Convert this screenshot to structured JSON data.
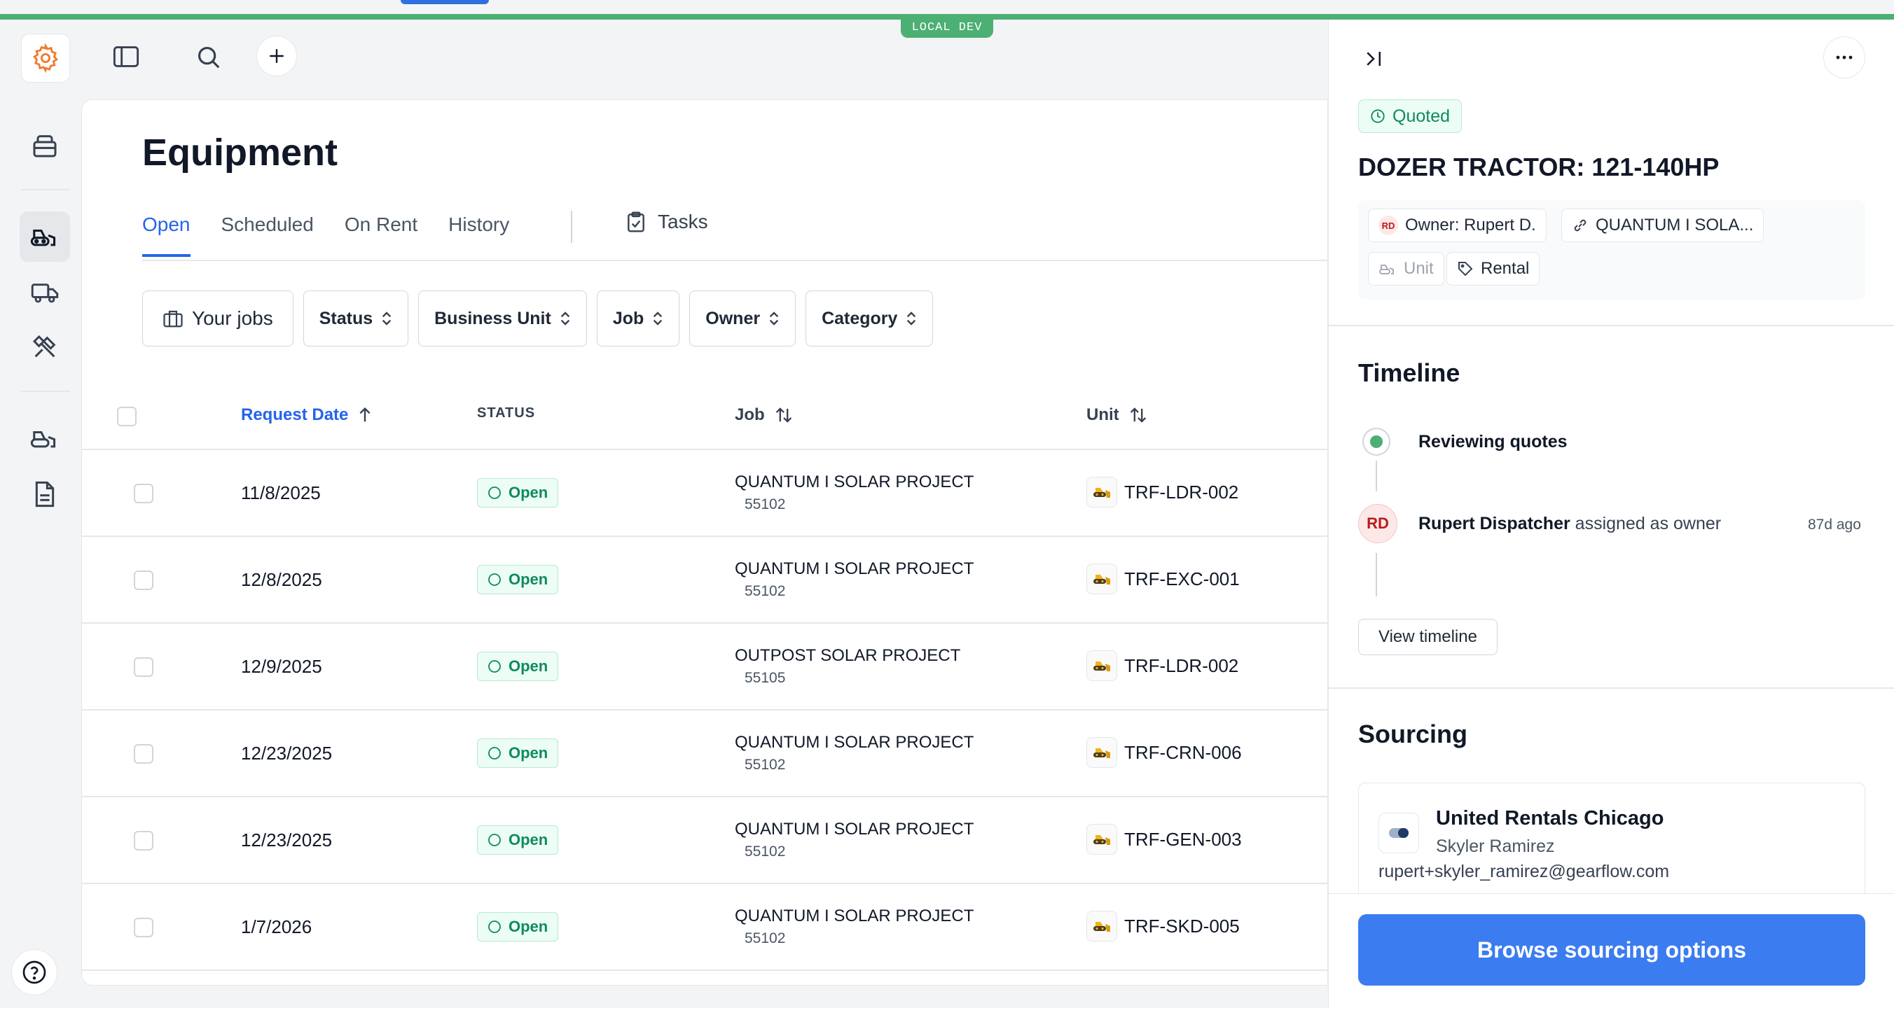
{
  "env_badge": "LOCAL DEV",
  "page": {
    "title": "Equipment",
    "tabs": [
      {
        "label": "Open",
        "active": true
      },
      {
        "label": "Scheduled",
        "active": false
      },
      {
        "label": "On Rent",
        "active": false
      },
      {
        "label": "History",
        "active": false
      }
    ],
    "tasks_label": "Tasks"
  },
  "filters": {
    "your_jobs": "Your jobs",
    "status": "Status",
    "business_unit": "Business Unit",
    "job": "Job",
    "owner": "Owner",
    "category": "Category"
  },
  "table": {
    "columns": {
      "request_date": "Request Date",
      "status": "STATUS",
      "job": "Job",
      "unit": "Unit"
    },
    "rows": [
      {
        "date": "11/8/2025",
        "status": "Open",
        "job": "QUANTUM I SOLAR PROJECT",
        "job_number": "55102",
        "unit": "TRF-LDR-002"
      },
      {
        "date": "12/8/2025",
        "status": "Open",
        "job": "QUANTUM I SOLAR PROJECT",
        "job_number": "55102",
        "unit": "TRF-EXC-001"
      },
      {
        "date": "12/9/2025",
        "status": "Open",
        "job": "OUTPOST SOLAR PROJECT",
        "job_number": "55105",
        "unit": "TRF-LDR-002"
      },
      {
        "date": "12/23/2025",
        "status": "Open",
        "job": "QUANTUM I SOLAR PROJECT",
        "job_number": "55102",
        "unit": "TRF-CRN-006"
      },
      {
        "date": "12/23/2025",
        "status": "Open",
        "job": "QUANTUM I SOLAR PROJECT",
        "job_number": "55102",
        "unit": "TRF-GEN-003"
      },
      {
        "date": "1/7/2026",
        "status": "Open",
        "job": "QUANTUM I SOLAR PROJECT",
        "job_number": "55102",
        "unit": "TRF-SKD-005"
      }
    ]
  },
  "panel": {
    "status_badge": "Quoted",
    "title": "DOZER TRACTOR: 121-140HP",
    "owner_initials": "RD",
    "owner_chip": "Owner: Rupert D.",
    "job_chip": "QUANTUM I SOLA...",
    "unit_chip": "Unit",
    "type_chip": "Rental",
    "timeline": {
      "title": "Timeline",
      "step1": "Reviewing quotes",
      "avatar": "RD",
      "actor": "Rupert Dispatcher",
      "action": " assigned as owner",
      "time": "87d ago",
      "view_button": "View timeline"
    },
    "sourcing": {
      "title": "Sourcing",
      "vendor": "United Rentals Chicago",
      "contact": "Skyler Ramirez",
      "email": "rupert+skyler_ramirez@gearflow.com"
    },
    "browse_button": "Browse sourcing options"
  },
  "colors": {
    "accent_green": "#4caf73",
    "primary_blue": "#2563eb",
    "button_blue": "#3b7cf0"
  }
}
